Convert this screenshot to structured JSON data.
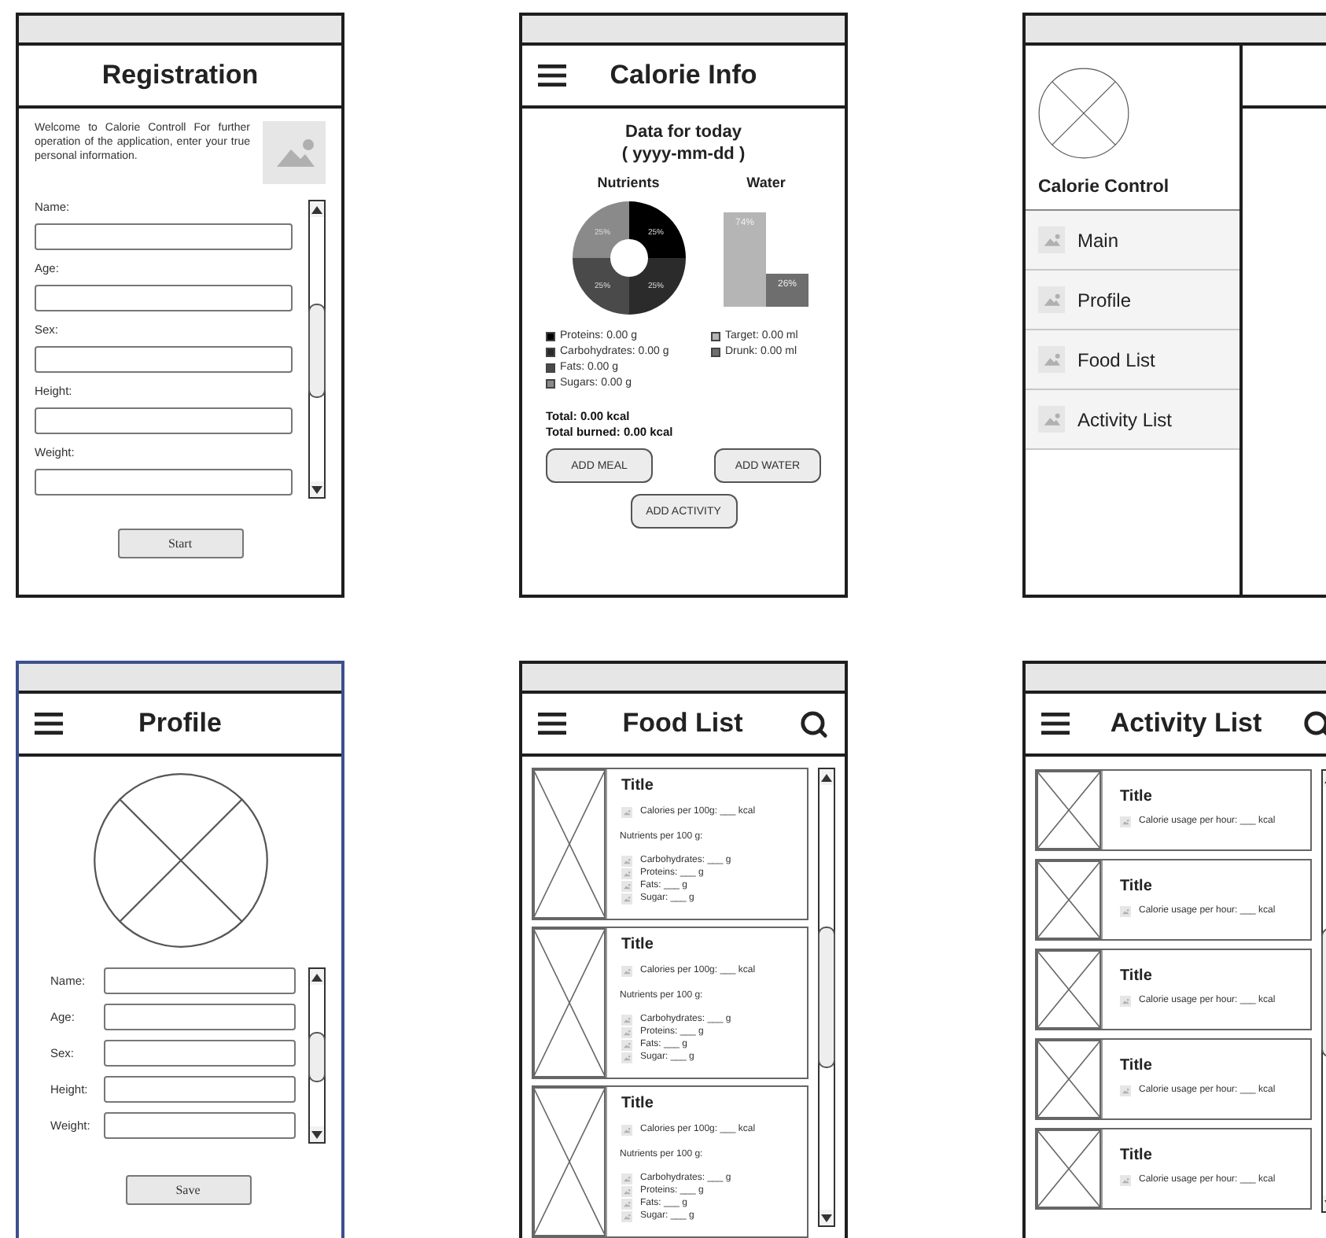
{
  "screens": [
    {
      "kind": "registration",
      "selected": false,
      "title": "Registration",
      "welcome": "Welcome to Calorie Controll For further operation of the application, enter your true personal information.",
      "fields": [
        {
          "label": "Name:"
        },
        {
          "label": "Age:"
        },
        {
          "label": "Sex:"
        },
        {
          "label": "Height:"
        },
        {
          "label": "Weight:"
        }
      ],
      "button": "Start"
    },
    {
      "kind": "calorie_info",
      "selected": false,
      "title": "Calorie Info",
      "heading": "Data for today",
      "date": "( yyyy-mm-dd )",
      "nutrients": {
        "title": "Nutrients",
        "slice_labels": [
          "25%",
          "25%",
          "25%",
          "25%"
        ]
      },
      "nutrient_legend": [
        {
          "label": "Proteins: 0.00 g",
          "color": "#000000"
        },
        {
          "label": "Carbohydrates: 0.00 g",
          "color": "#2b2b2b"
        },
        {
          "label": "Fats: 0.00 g",
          "color": "#4a4a4a"
        },
        {
          "label": "Sugars: 0.00 g",
          "color": "#8a8a8a"
        }
      ],
      "water": {
        "title": "Water",
        "bar_labels": [
          "74%",
          "26%"
        ]
      },
      "water_legend": [
        {
          "label": "Target: 0.00 ml",
          "color": "#b5b5b5"
        },
        {
          "label": "Drunk: 0.00 ml",
          "color": "#6e6e6e"
        }
      ],
      "totals": [
        "Total: 0.00 kcal",
        "Total burned: 0.00 kcal"
      ],
      "buttons": [
        "ADD MEAL",
        "ADD WATER",
        "ADD ACTIVITY"
      ]
    },
    {
      "kind": "drawer",
      "selected": false,
      "app_name": "Calorie Control",
      "menu": [
        {
          "label": "Main"
        },
        {
          "label": "Profile"
        },
        {
          "label": "Food List"
        },
        {
          "label": "Activity List"
        }
      ]
    },
    {
      "kind": "profile",
      "selected": true,
      "title": "Profile",
      "fields": [
        {
          "label": "Name:"
        },
        {
          "label": "Age:"
        },
        {
          "label": "Sex:"
        },
        {
          "label": "Height:"
        },
        {
          "label": "Weight:"
        }
      ],
      "button": "Save"
    },
    {
      "kind": "food_list",
      "selected": false,
      "title": "Food List",
      "items": [
        {
          "title": "Title",
          "calories": "Calories per 100g: ___ kcal",
          "nutrients_heading": "Nutrients per 100 g:",
          "nutrients": [
            "Carbohydrates: ___ g",
            "Proteins: ___ g",
            "Fats: ___ g",
            "Sugar: ___ g"
          ]
        },
        {
          "title": "Title",
          "calories": "Calories per 100g: ___ kcal",
          "nutrients_heading": "Nutrients per 100 g:",
          "nutrients": [
            "Carbohydrates: ___ g",
            "Proteins: ___ g",
            "Fats: ___ g",
            "Sugar: ___ g"
          ]
        },
        {
          "title": "Title",
          "calories": "Calories per 100g: ___ kcal",
          "nutrients_heading": "Nutrients per 100 g:",
          "nutrients": [
            "Carbohydrates: ___ g",
            "Proteins: ___ g",
            "Fats: ___ g",
            "Sugar: ___ g"
          ]
        }
      ]
    },
    {
      "kind": "activity_list",
      "selected": false,
      "title": "Activity List",
      "items": [
        {
          "title": "Title",
          "usage": "Calorie usage per hour: ___ kcal"
        },
        {
          "title": "Title",
          "usage": "Calorie usage per hour: ___ kcal"
        },
        {
          "title": "Title",
          "usage": "Calorie usage per hour: ___ kcal"
        },
        {
          "title": "Title",
          "usage": "Calorie usage per hour: ___ kcal"
        },
        {
          "title": "Title",
          "usage": "Calorie usage per hour: ___ kcal"
        }
      ]
    }
  ]
}
